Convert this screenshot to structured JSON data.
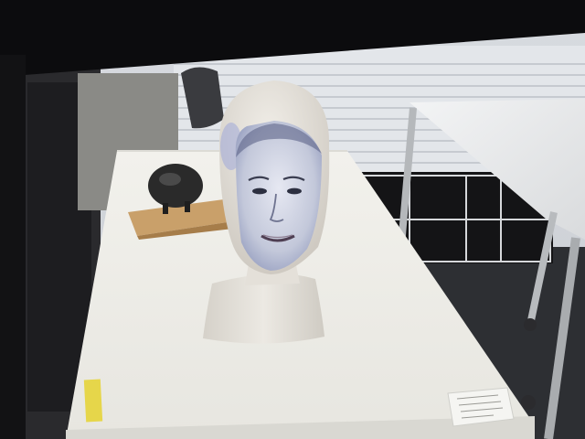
{
  "scene": {
    "subject": "projected-face-mannequin-head",
    "colors": {
      "top_frame": "#0d0d0f",
      "background_wall": "#e6e8ec",
      "window_blinds": "#d9dde2",
      "table_left": "#ecebe6",
      "table_right": "#e4e6e8",
      "floor": "#2a2c30",
      "head": "#e8e4dd",
      "face_projection": "#b9c0d4",
      "pedestal": "#e2dfd8",
      "wood_base": "#c9a06a",
      "sculpture": "#2b2b2b"
    }
  }
}
